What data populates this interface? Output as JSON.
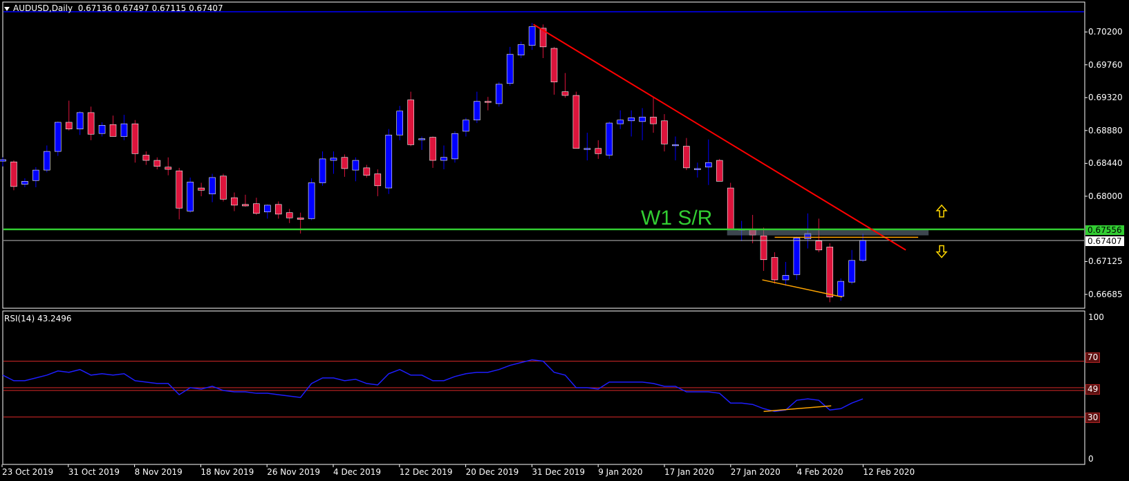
{
  "header": {
    "symbol": "AUDUSD,Daily",
    "open": "0.67136",
    "high": "0.67497",
    "low": "0.67115",
    "close": "0.67407"
  },
  "annotation": {
    "sr_label": "W1 S/R"
  },
  "price_axis": {
    "ticks": [
      "0.70200",
      "0.69760",
      "0.69320",
      "0.68880",
      "0.68440",
      "0.68000",
      "0.67125",
      "0.66685"
    ],
    "sr_tag": "0.67556",
    "close_tag": "0.67407"
  },
  "rsi": {
    "title": "RSI(14) 43.2496",
    "axis_ticks": [
      "100",
      "0"
    ],
    "level_tags": [
      "70",
      "49",
      "30"
    ]
  },
  "dates": [
    "23 Oct 2019",
    "31 Oct 2019",
    "8 Nov 2019",
    "18 Nov 2019",
    "26 Nov 2019",
    "4 Dec 2019",
    "12 Dec 2019",
    "20 Dec 2019",
    "31 Dec 2019",
    "9 Jan 2020",
    "17 Jan 2020",
    "27 Jan 2020",
    "4 Feb 2020",
    "12 Feb 2020"
  ],
  "colors": {
    "bull": "#0000ff",
    "bear": "#dc143c",
    "sr_line": "#32cd32",
    "trend_line": "#ff0000",
    "divergence": "#ffa500",
    "rsi_line": "#1e1eff",
    "rsi_levels": "#b22222",
    "arrows": "#ffd700",
    "background": "#000000",
    "frame": "#ffffff"
  },
  "chart_data": {
    "type": "candlestick",
    "title": "AUDUSD,Daily",
    "ylim": [
      0.665,
      0.706
    ],
    "sr_level": 0.67556,
    "last_close": 0.67407,
    "trendline": [
      [
        0.703,
        0
      ],
      [
        0.6728,
        1
      ]
    ],
    "ohlc": [
      [
        0.6847,
        0.6852,
        0.684,
        0.6849
      ],
      [
        0.6846,
        0.6848,
        0.6808,
        0.6813
      ],
      [
        0.6816,
        0.6824,
        0.6812,
        0.682
      ],
      [
        0.6821,
        0.6839,
        0.6812,
        0.6835
      ],
      [
        0.6835,
        0.6868,
        0.6832,
        0.686
      ],
      [
        0.686,
        0.69,
        0.6854,
        0.6899
      ],
      [
        0.6899,
        0.6928,
        0.6888,
        0.689
      ],
      [
        0.689,
        0.6914,
        0.6882,
        0.6912
      ],
      [
        0.6912,
        0.692,
        0.6875,
        0.6883
      ],
      [
        0.6884,
        0.6899,
        0.688,
        0.6895
      ],
      [
        0.6896,
        0.6908,
        0.6888,
        0.688
      ],
      [
        0.688,
        0.6909,
        0.6875,
        0.6897
      ],
      [
        0.6897,
        0.6902,
        0.6845,
        0.6857
      ],
      [
        0.6855,
        0.686,
        0.6842,
        0.6848
      ],
      [
        0.6848,
        0.6852,
        0.6836,
        0.684
      ],
      [
        0.6839,
        0.6852,
        0.6828,
        0.6836
      ],
      [
        0.6834,
        0.6838,
        0.6769,
        0.6784
      ],
      [
        0.678,
        0.6825,
        0.6778,
        0.6819
      ],
      [
        0.6811,
        0.6818,
        0.68,
        0.6808
      ],
      [
        0.6803,
        0.683,
        0.6792,
        0.6825
      ],
      [
        0.6827,
        0.683,
        0.6793,
        0.6796
      ],
      [
        0.6798,
        0.6805,
        0.678,
        0.6788
      ],
      [
        0.6789,
        0.6802,
        0.6786,
        0.6787
      ],
      [
        0.679,
        0.6798,
        0.6775,
        0.6777
      ],
      [
        0.6779,
        0.6789,
        0.677,
        0.6788
      ],
      [
        0.6789,
        0.6793,
        0.677,
        0.6776
      ],
      [
        0.6778,
        0.6783,
        0.6764,
        0.6771
      ],
      [
        0.6771,
        0.6778,
        0.675,
        0.6769
      ],
      [
        0.677,
        0.6824,
        0.6768,
        0.6818
      ],
      [
        0.6818,
        0.686,
        0.6814,
        0.685
      ],
      [
        0.6848,
        0.686,
        0.683,
        0.6851
      ],
      [
        0.6852,
        0.6856,
        0.6826,
        0.6837
      ],
      [
        0.6835,
        0.6852,
        0.682,
        0.6848
      ],
      [
        0.6838,
        0.6842,
        0.6825,
        0.6828
      ],
      [
        0.683,
        0.6836,
        0.68,
        0.6814
      ],
      [
        0.6811,
        0.689,
        0.6803,
        0.6882
      ],
      [
        0.6882,
        0.6921,
        0.6875,
        0.6914
      ],
      [
        0.6929,
        0.694,
        0.6867,
        0.6869
      ],
      [
        0.6876,
        0.688,
        0.6862,
        0.6877
      ],
      [
        0.6879,
        0.688,
        0.6838,
        0.6848
      ],
      [
        0.6848,
        0.6868,
        0.6836,
        0.6852
      ],
      [
        0.685,
        0.6887,
        0.6845,
        0.6884
      ],
      [
        0.6887,
        0.6905,
        0.688,
        0.6902
      ],
      [
        0.6902,
        0.694,
        0.6898,
        0.6927
      ],
      [
        0.6927,
        0.6933,
        0.6915,
        0.6926
      ],
      [
        0.6924,
        0.6953,
        0.692,
        0.695
      ],
      [
        0.6951,
        0.7,
        0.6948,
        0.699
      ],
      [
        0.6989,
        0.7007,
        0.6985,
        0.7003
      ],
      [
        0.7002,
        0.7032,
        0.6996,
        0.7027
      ],
      [
        0.7025,
        0.703,
        0.6985,
        0.7
      ],
      [
        0.6998,
        0.7,
        0.6936,
        0.6953
      ],
      [
        0.694,
        0.6965,
        0.6932,
        0.6935
      ],
      [
        0.6935,
        0.694,
        0.6866,
        0.6864
      ],
      [
        0.6864,
        0.6885,
        0.6848,
        0.6864
      ],
      [
        0.6864,
        0.6875,
        0.685,
        0.6857
      ],
      [
        0.6855,
        0.69,
        0.685,
        0.6898
      ],
      [
        0.6897,
        0.6915,
        0.689,
        0.6902
      ],
      [
        0.6901,
        0.6915,
        0.688,
        0.6905
      ],
      [
        0.69,
        0.6918,
        0.6875,
        0.6906
      ],
      [
        0.6906,
        0.6933,
        0.6885,
        0.6897
      ],
      [
        0.6901,
        0.691,
        0.686,
        0.687
      ],
      [
        0.6868,
        0.688,
        0.6848,
        0.6869
      ],
      [
        0.6867,
        0.6878,
        0.6835,
        0.6838
      ],
      [
        0.6836,
        0.6845,
        0.6825,
        0.6837
      ],
      [
        0.6839,
        0.6876,
        0.6815,
        0.6845
      ],
      [
        0.6848,
        0.685,
        0.682,
        0.682
      ],
      [
        0.6811,
        0.6818,
        0.6755,
        0.6756
      ],
      [
        0.6756,
        0.6767,
        0.674,
        0.6756
      ],
      [
        0.6755,
        0.6775,
        0.6737,
        0.6748
      ],
      [
        0.6747,
        0.6758,
        0.67,
        0.6715
      ],
      [
        0.6718,
        0.6725,
        0.6683,
        0.6688
      ],
      [
        0.6688,
        0.6712,
        0.668,
        0.6694
      ],
      [
        0.6695,
        0.6746,
        0.6688,
        0.6744
      ],
      [
        0.6743,
        0.6777,
        0.673,
        0.675
      ],
      [
        0.674,
        0.677,
        0.6725,
        0.6728
      ],
      [
        0.6732,
        0.6737,
        0.6658,
        0.6665
      ],
      [
        0.6666,
        0.669,
        0.666,
        0.6686
      ],
      [
        0.6685,
        0.6728,
        0.6682,
        0.6714
      ],
      [
        0.6714,
        0.675,
        0.6712,
        0.6741
      ]
    ],
    "rsi_levels": [
      70,
      49,
      30
    ],
    "rsi_ylim": [
      0,
      100
    ],
    "rsi_values": [
      60,
      56,
      56,
      58,
      60,
      63,
      62,
      64,
      60,
      61,
      60,
      61,
      56,
      55,
      54,
      54,
      46,
      51,
      50,
      52,
      49,
      48,
      48,
      47,
      47,
      46,
      45,
      44,
      54,
      58,
      58,
      56,
      57,
      54,
      53,
      61,
      64,
      60,
      60,
      56,
      56,
      59,
      61,
      62,
      62,
      64,
      67,
      69,
      71,
      70,
      62,
      60,
      51,
      51,
      50,
      55,
      55,
      55,
      55,
      54,
      52,
      52,
      48,
      48,
      48,
      47,
      40,
      40,
      39,
      36,
      34,
      35,
      42,
      43,
      42,
      35,
      36,
      40,
      43
    ]
  }
}
